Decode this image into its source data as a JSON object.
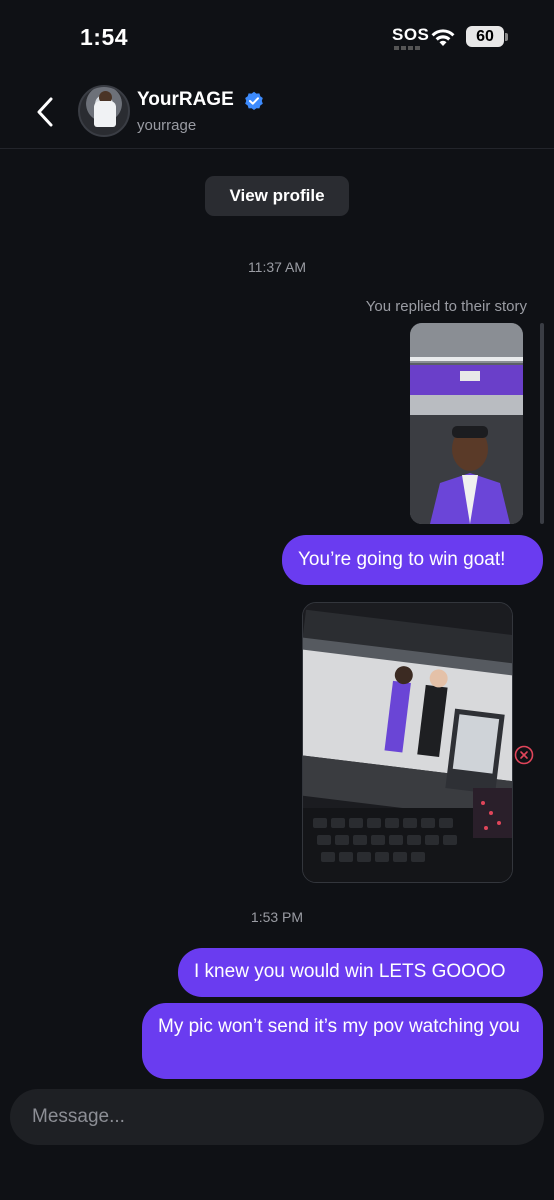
{
  "status_bar": {
    "time": "1:54",
    "sos": "SOS",
    "battery": "60"
  },
  "header": {
    "name": "YourRAGE",
    "handle": "yourrage"
  },
  "view_profile_label": "View profile",
  "thread": {
    "timestamp_1": "11:37 AM",
    "story_reply_note": "You replied to their story",
    "message_1": "You’re going to win goat!",
    "timestamp_2": "1:53 PM",
    "message_2": "I knew you would win LETS GOOOO",
    "message_3": "My pic won’t send it’s my pov watching you"
  },
  "composer": {
    "placeholder": "Message..."
  },
  "colors": {
    "background": "#0f1115",
    "bubble": "#6a3cf0",
    "verified": "#3d8bfd",
    "error": "#e0455a"
  }
}
